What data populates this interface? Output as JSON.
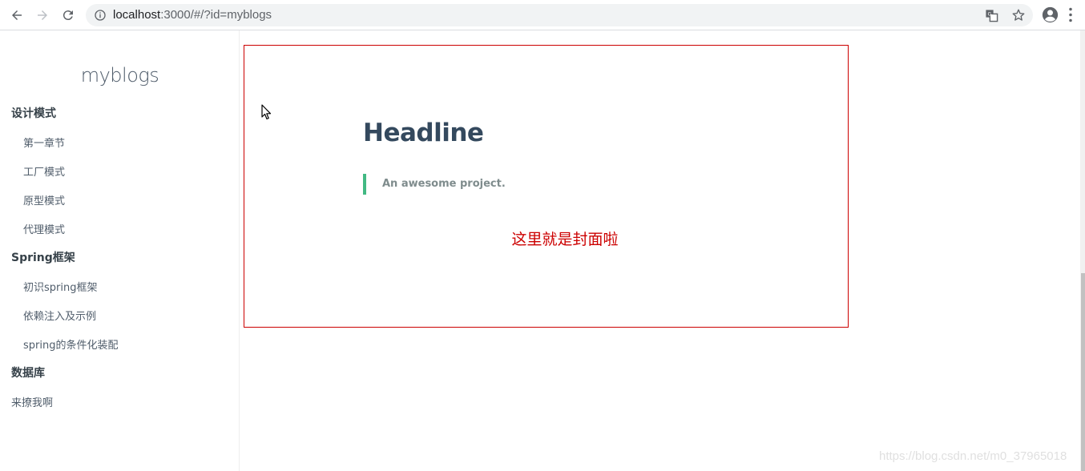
{
  "browser": {
    "url_host": "localhost",
    "url_rest": ":3000/#/?id=myblogs",
    "icons": [
      "back-icon",
      "forward-icon",
      "reload-icon",
      "info-icon",
      "translate-icon",
      "star-icon",
      "profile-icon",
      "menu-icon"
    ]
  },
  "sidebar": {
    "app_name": "myblogs",
    "sections": [
      {
        "label": "设计模式",
        "items": [
          "第一章节",
          "工厂模式",
          "原型模式",
          "代理模式"
        ]
      },
      {
        "label": "Spring框架",
        "items": [
          "初识spring框架",
          "依赖注入及示例",
          "spring的条件化装配"
        ]
      },
      {
        "label": "数据库",
        "items": []
      }
    ],
    "plain_item": "来撩我啊"
  },
  "main": {
    "headline": "Headline",
    "tagline": "An awesome project.",
    "cover_note": "这里就是封面啦"
  },
  "watermark": "https://blog.csdn.net/m0_37965018",
  "colors": {
    "accent_green": "#42b983",
    "cover_red": "#cc0000",
    "heading": "#34495e"
  }
}
